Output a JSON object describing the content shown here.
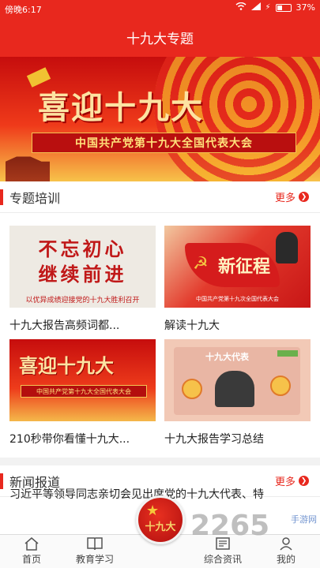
{
  "status_bar": {
    "time": "傍晚6:17",
    "battery": "37%"
  },
  "header": {
    "title": "十九大专题"
  },
  "banner": {
    "headline": "喜迎十九大",
    "subline": "中国共产党第十九大全国代表大会"
  },
  "training": {
    "title": "专题培训",
    "more_label": "更多",
    "items": [
      {
        "caption": "十九大报告高频词都...",
        "thumb_line1": "不忘初心",
        "thumb_line2": "继续前进",
        "thumb_line3": "以优异成绩迎接党的十九大胜利召开"
      },
      {
        "caption": "解读十九大",
        "thumb_title": "新征程",
        "thumb_sub": "中国共产党第十九次全国代表大会"
      },
      {
        "caption": "210秒带你看懂十九大...",
        "thumb_headline": "喜迎十九大",
        "thumb_sub": "中国共产党第十九大全国代表大会"
      },
      {
        "caption": "十九大报告学习总结",
        "thumb_label": "十九大代表"
      }
    ]
  },
  "news": {
    "title": "新闻报道",
    "more_label": "更多",
    "first_item": "习近平等领导同志亲切会见出席党的十九大代表、特"
  },
  "tabbar": {
    "items": [
      {
        "label": "首页",
        "icon": "home-icon"
      },
      {
        "label": "教育学习",
        "icon": "book-icon"
      },
      {
        "label": "综合资讯",
        "icon": "news-icon"
      },
      {
        "label": "我的",
        "icon": "user-icon"
      }
    ],
    "center_label": "十九大"
  },
  "watermark": {
    "big": "2265",
    "small": "手游网"
  },
  "colors": {
    "primary": "#e8281e",
    "gold": "#f6c83a"
  }
}
